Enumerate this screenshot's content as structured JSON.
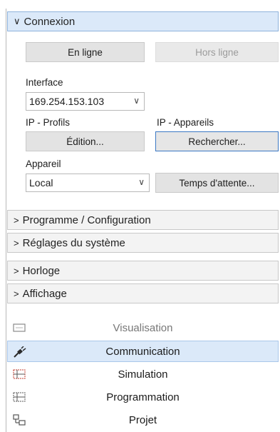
{
  "sections": {
    "connexion": {
      "label": "Connexion",
      "online_label": "En ligne",
      "offline_label": "Hors ligne",
      "interface_label": "Interface",
      "interface_value": "169.254.153.103",
      "ip_profiles_label": "IP - Profils",
      "ip_devices_label": "IP - Appareils",
      "edit_label": "Édition...",
      "search_label": "Rechercher...",
      "device_label": "Appareil",
      "device_value": "Local",
      "timeout_label": "Temps d'attente..."
    },
    "programme": {
      "label": "Programme / Configuration"
    },
    "reglages": {
      "label": "Réglages du système"
    },
    "horloge": {
      "label": "Horloge"
    },
    "affichage": {
      "label": "Affichage"
    }
  },
  "bottom_items": [
    {
      "label": "Visualisation",
      "icon": "monitor-icon"
    },
    {
      "label": "Communication",
      "icon": "connector-icon"
    },
    {
      "label": "Simulation",
      "icon": "simulation-icon"
    },
    {
      "label": "Programmation",
      "icon": "programming-icon"
    },
    {
      "label": "Projet",
      "icon": "project-icon"
    }
  ],
  "colors": {
    "accent": "#3b78c4",
    "selection": "#dbe9f9",
    "icon_red": "#c0392b"
  }
}
